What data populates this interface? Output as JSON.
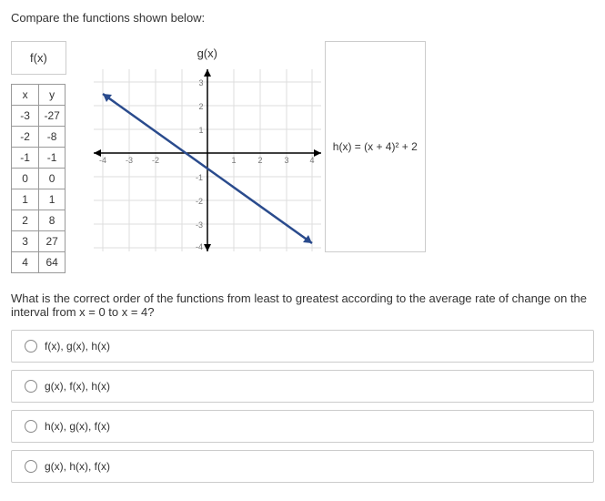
{
  "prompt": "Compare the functions shown below:",
  "f_label": "f(x)",
  "g_label": "g(x)",
  "h_formula": "h(x) = (x + 4)² + 2",
  "table": {
    "headers": [
      "x",
      "y"
    ],
    "rows": [
      [
        "-3",
        "-27"
      ],
      [
        "-2",
        "-8"
      ],
      [
        "-1",
        "-1"
      ],
      [
        "0",
        "0"
      ],
      [
        "1",
        "1"
      ],
      [
        "2",
        "8"
      ],
      [
        "3",
        "27"
      ],
      [
        "4",
        "64"
      ]
    ]
  },
  "chart_data": {
    "type": "line",
    "title": "",
    "xlabel": "",
    "ylabel": "",
    "xlim": [
      -4,
      4
    ],
    "ylim": [
      -4,
      3.5
    ],
    "xticks": [
      -4,
      -3,
      -2,
      -1,
      1,
      2,
      3,
      4
    ],
    "yticks": [
      -4,
      -3,
      -2,
      -1,
      1,
      2,
      3
    ],
    "series": [
      {
        "name": "g(x)",
        "points": [
          [
            -4,
            2.5
          ],
          [
            4,
            -3.8
          ]
        ]
      }
    ]
  },
  "question": "What is the correct order of the functions from least to greatest according to the average rate of change on the interval from x = 0 to x = 4?",
  "options": [
    "f(x), g(x), h(x)",
    "g(x), f(x), h(x)",
    "h(x), g(x), f(x)",
    "g(x), h(x), f(x)"
  ]
}
